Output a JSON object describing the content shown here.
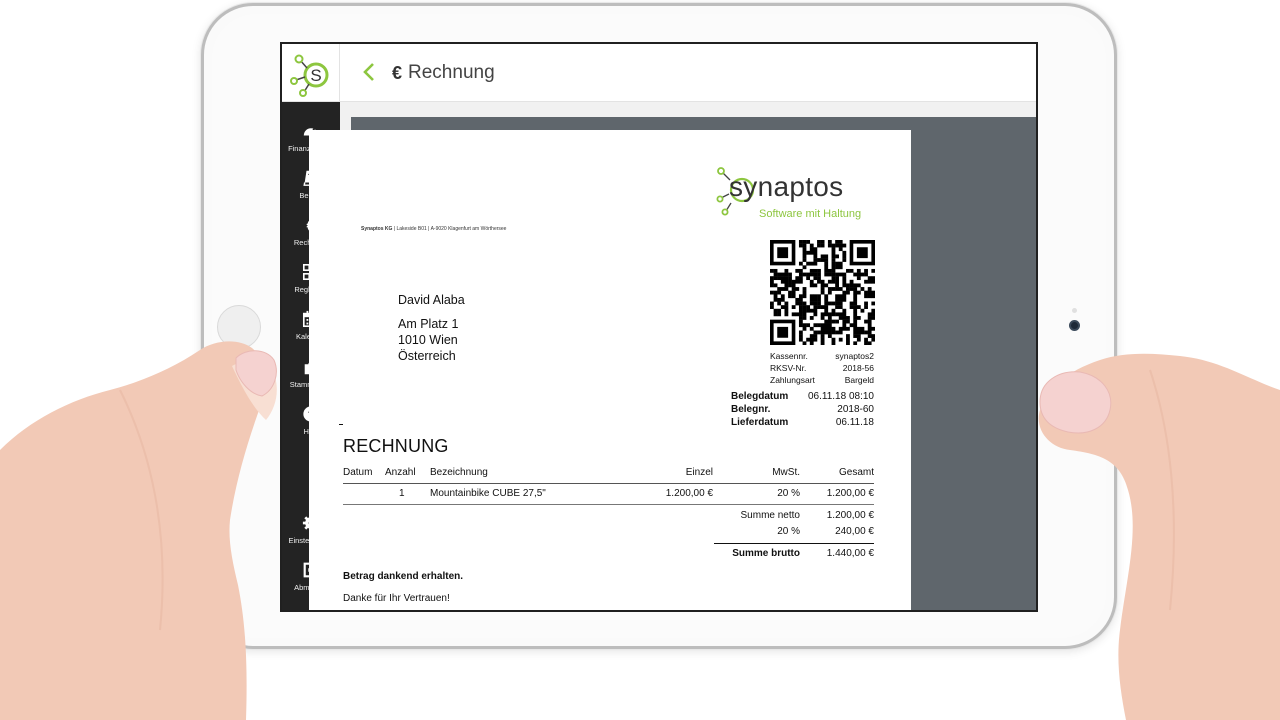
{
  "app": {
    "title": "Rechnung",
    "title_icon": "euro-icon",
    "accent_color": "#8dc63f",
    "sidebar_bg": "#232323"
  },
  "sidebar": {
    "items": [
      {
        "label": "Finanzcockpit",
        "icon": "speedometer-icon"
      },
      {
        "label": "Belege",
        "icon": "book-icon"
      },
      {
        "label": "Rechnung",
        "icon": "euro-icon"
      },
      {
        "label": "Regkasse",
        "icon": "qr-code-icon"
      },
      {
        "label": "Kalender",
        "icon": "calendar-icon"
      },
      {
        "label": "Stammdaten",
        "icon": "puzzle-icon"
      },
      {
        "label": "Hilfe",
        "icon": "help-icon"
      }
    ],
    "bottom_items": [
      {
        "label": "Einstellungen",
        "icon": "gear-icon"
      },
      {
        "label": "Abmelden",
        "icon": "logout-icon"
      }
    ]
  },
  "invoice": {
    "logo_text": "synaptos",
    "slogan": "Software mit Haltung",
    "sender_name": "Synaptos KG",
    "sender_address": " | Lakeside B01 | A-9020 Klagenfurt am Wörthersee",
    "recipient": {
      "name": "David Alaba",
      "street": "Am Platz 1",
      "city": "1010 Wien",
      "country": "Österreich"
    },
    "register": [
      {
        "label": "Kassennr.",
        "value": "synaptos2"
      },
      {
        "label": "RKSV-Nr.",
        "value": "2018-56"
      },
      {
        "label": "Zahlungsart",
        "value": "Bargeld"
      }
    ],
    "dates": [
      {
        "label": "Belegdatum",
        "value": "06.11.18 08:10"
      },
      {
        "label": "Belegnr.",
        "value": "2018-60"
      },
      {
        "label": "Lieferdatum",
        "value": "06.11.18"
      }
    ],
    "heading": "RECHNUNG",
    "columns": [
      "Datum",
      "Anzahl",
      "Bezeichnung",
      "Einzel",
      "MwSt.",
      "Gesamt"
    ],
    "rows": [
      {
        "datum": "",
        "anzahl": "1",
        "bezeichnung": "Mountainbike CUBE 27,5\"",
        "einzel": "1.200,00 €",
        "mwst": "20 %",
        "gesamt": "1.200,00 €"
      }
    ],
    "summe_netto_label": "Summe netto",
    "summe_netto": "1.200,00 €",
    "tax_rate": "20 %",
    "tax_amount": "240,00 €",
    "summe_brutto_label": "Summe brutto",
    "summe_brutto": "1.440,00 €",
    "thanks_bold": "Betrag dankend erhalten.",
    "thanks": "Danke für Ihr Vertrauen!"
  }
}
